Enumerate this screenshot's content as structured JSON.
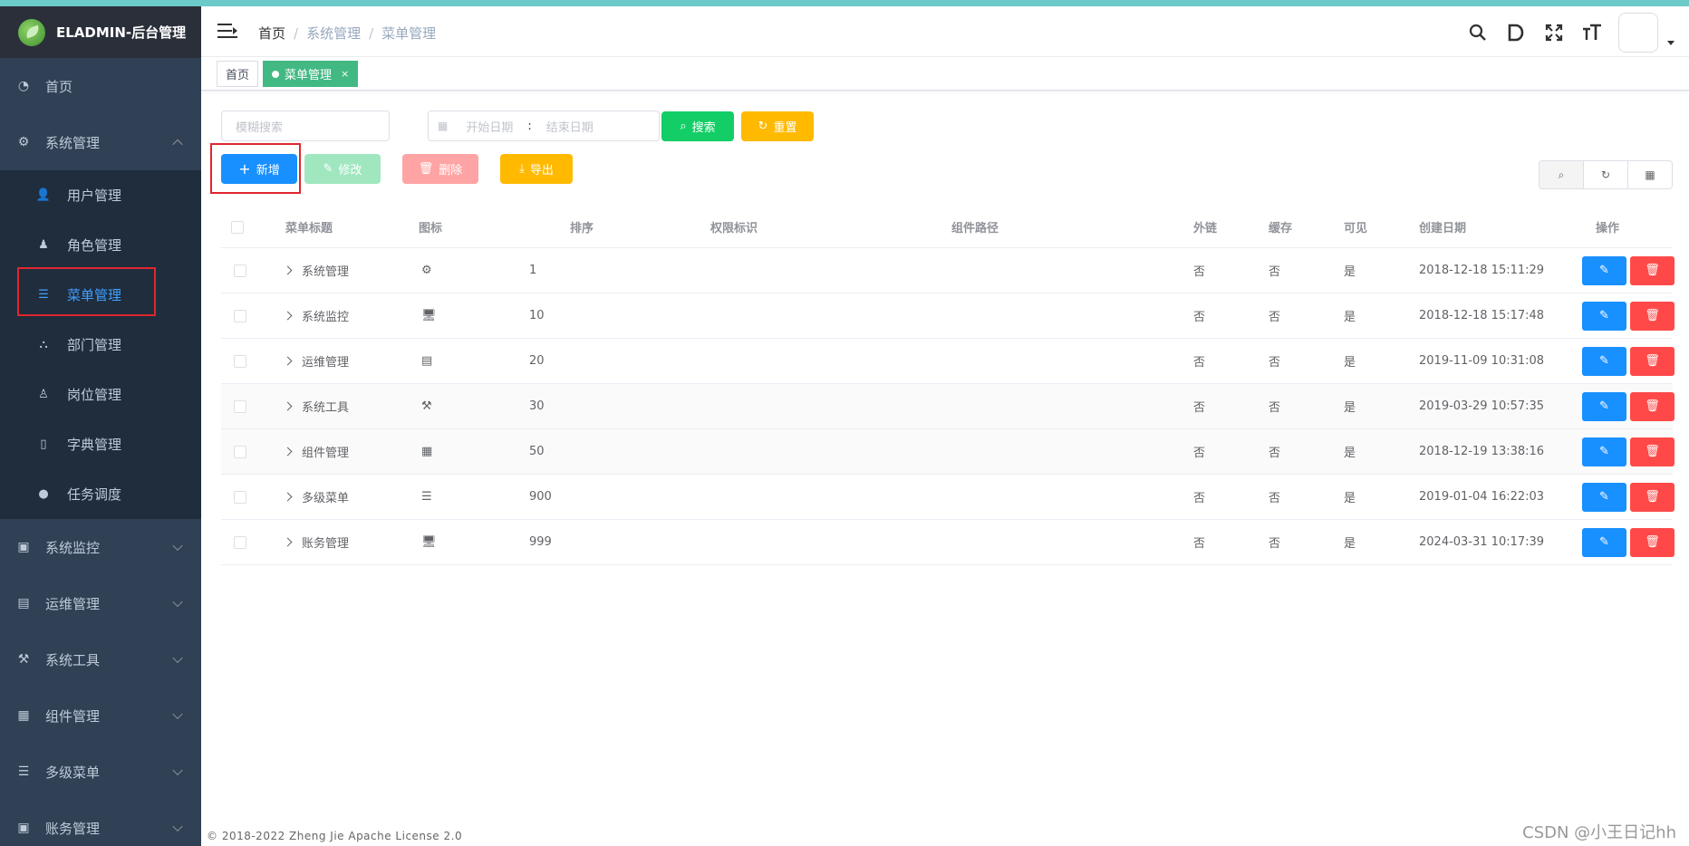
{
  "brand": {
    "title": "ELADMIN-后台管理"
  },
  "sidebar": {
    "top_item": {
      "label": "首页",
      "icon": "dashboard-icon"
    },
    "system": {
      "label": "系统管理",
      "icon": "gear-icon"
    },
    "sub_items": [
      {
        "label": "用户管理",
        "icon": "user-icon"
      },
      {
        "label": "角色管理",
        "icon": "role-icon"
      },
      {
        "label": "菜单管理",
        "icon": "menu-icon"
      },
      {
        "label": "部门管理",
        "icon": "dept-icon"
      },
      {
        "label": "岗位管理",
        "icon": "post-icon"
      },
      {
        "label": "字典管理",
        "icon": "dict-icon"
      },
      {
        "label": "任务调度",
        "icon": "timer-icon"
      }
    ],
    "other_items": [
      {
        "label": "系统监控",
        "icon": "monitor-icon"
      },
      {
        "label": "运维管理",
        "icon": "ops-icon"
      },
      {
        "label": "系统工具",
        "icon": "tools-icon"
      },
      {
        "label": "组件管理",
        "icon": "component-icon"
      },
      {
        "label": "多级菜单",
        "icon": "menu-icon"
      },
      {
        "label": "账务管理",
        "icon": "monitor-icon"
      }
    ]
  },
  "breadcrumb": {
    "home": "首页",
    "section": "系统管理",
    "page": "菜单管理"
  },
  "tags": {
    "home": "首页",
    "current": "菜单管理",
    "close": "×"
  },
  "filters": {
    "search_placeholder": "模糊搜索",
    "start_placeholder": "开始日期",
    "range_sep": ":",
    "end_placeholder": "结束日期",
    "search_btn": "搜索",
    "reset_btn": "重置"
  },
  "actions": {
    "add": "新增",
    "edit": "修改",
    "delete": "删除",
    "export": "导出"
  },
  "table": {
    "headers": {
      "title": "菜单标题",
      "icon": "图标",
      "sort": "排序",
      "permission": "权限标识",
      "component": "组件路径",
      "iframe": "外链",
      "cache": "缓存",
      "visible": "可见",
      "created": "创建日期",
      "ops": "操作"
    },
    "rows": [
      {
        "title": "系统管理",
        "icon": "⚙",
        "sort": "1",
        "permission": "",
        "component": "",
        "iframe": "否",
        "cache": "否",
        "visible": "是",
        "created": "2018-12-18 15:11:29"
      },
      {
        "title": "系统监控",
        "icon": "🖥",
        "sort": "10",
        "permission": "",
        "component": "",
        "iframe": "否",
        "cache": "否",
        "visible": "是",
        "created": "2018-12-18 15:17:48"
      },
      {
        "title": "运维管理",
        "icon": "▤",
        "sort": "20",
        "permission": "",
        "component": "",
        "iframe": "否",
        "cache": "否",
        "visible": "是",
        "created": "2019-11-09 10:31:08"
      },
      {
        "title": "系统工具",
        "icon": "⚒",
        "sort": "30",
        "permission": "",
        "component": "",
        "iframe": "否",
        "cache": "否",
        "visible": "是",
        "created": "2019-03-29 10:57:35"
      },
      {
        "title": "组件管理",
        "icon": "▦",
        "sort": "50",
        "permission": "",
        "component": "",
        "iframe": "否",
        "cache": "否",
        "visible": "是",
        "created": "2018-12-19 13:38:16"
      },
      {
        "title": "多级菜单",
        "icon": "☰",
        "sort": "900",
        "permission": "",
        "component": "",
        "iframe": "否",
        "cache": "否",
        "visible": "是",
        "created": "2019-01-04 16:22:03"
      },
      {
        "title": "账务管理",
        "icon": "🖥",
        "sort": "999",
        "permission": "",
        "component": "",
        "iframe": "否",
        "cache": "否",
        "visible": "是",
        "created": "2024-03-31 10:17:39"
      }
    ]
  },
  "footer": {
    "text": "© 2018-2022 Zheng Jie Apache License 2.0"
  },
  "watermark": {
    "text": "CSDN @小王日记hh"
  },
  "colors": {
    "primary": "#1890ff",
    "success": "#13ce66",
    "warning": "#ffba00",
    "danger": "#ff4949",
    "sidebar_bg": "#304156",
    "tag_active": "#42b983",
    "highlight": "#e0262e"
  }
}
